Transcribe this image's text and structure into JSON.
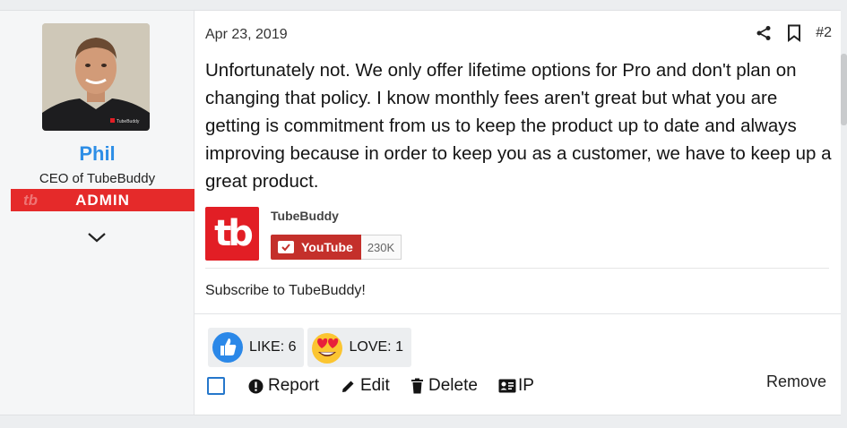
{
  "user": {
    "name": "Phil",
    "title": "CEO of TubeBuddy",
    "banner": "ADMIN",
    "banner_mark": "tb",
    "shirt_logo": "TubeBuddy"
  },
  "post": {
    "date": "Apr 23, 2019",
    "number": "#2",
    "body": "Unfortunately not. We only offer lifetime options for Pro and don't plan on changing that policy. I know monthly fees aren't great but what you are getting is commitment from us to keep the product up to date and always improving because in order to keep you as a customer, we have to keep up a great product."
  },
  "embed": {
    "logo_text": "tb",
    "channel": "TubeBuddy",
    "youtube_label": "YouTube",
    "subscriber_count": "230K",
    "caption": "Subscribe to TubeBuddy!"
  },
  "reactions": [
    {
      "label": "LIKE: 6",
      "icon": "like-icon"
    },
    {
      "label": "LOVE: 1",
      "icon": "love-icon"
    }
  ],
  "actions": {
    "report": "Report",
    "edit": "Edit",
    "delete": "Delete",
    "ip": "IP",
    "remove": "Remove"
  },
  "colors": {
    "username": "#2e8ee6",
    "admin_banner": "#e52a2a",
    "youtube_red": "#c4302b",
    "like_blue": "#2b88e8",
    "checkbox_blue": "#2577cb"
  }
}
